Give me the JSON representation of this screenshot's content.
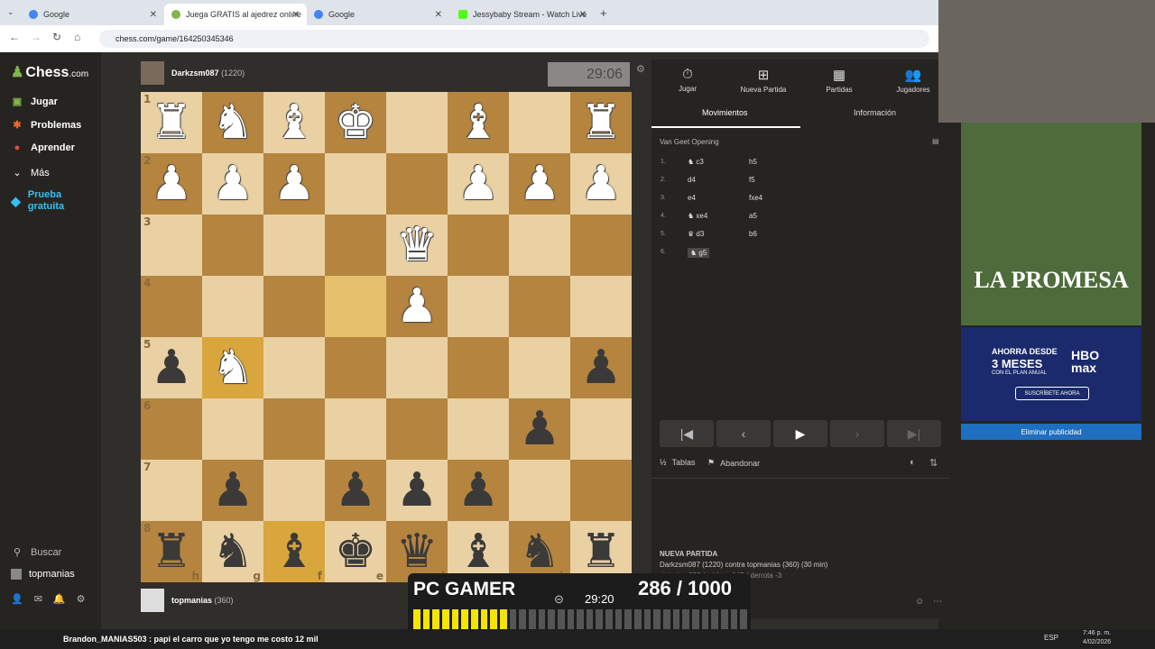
{
  "browser": {
    "tabs": [
      {
        "title": "Google",
        "favicon_color": "#4285f4",
        "active": false
      },
      {
        "title": "Juega GRATIS al ajedrez online",
        "favicon_color": "#81b64c",
        "active": true
      },
      {
        "title": "Google",
        "favicon_color": "#4285f4",
        "active": false
      },
      {
        "title": "Jessybaby Stream - Watch Live",
        "favicon_color": "#53fc18",
        "active": false
      }
    ],
    "url": "chess.com/game/164250345346"
  },
  "sidebar": {
    "logo": "Chess",
    "logo_suffix": ".com",
    "items": [
      {
        "label": "Jugar",
        "icon": "play-icon"
      },
      {
        "label": "Problemas",
        "icon": "puzzle-icon"
      },
      {
        "label": "Aprender",
        "icon": "learn-icon"
      },
      {
        "label": "Más",
        "icon": "chevron-down-icon"
      },
      {
        "label": "Prueba gratuita",
        "icon": "diamond-icon"
      }
    ],
    "search": "Buscar",
    "username": "topmanias"
  },
  "game": {
    "top_player": {
      "name": "Darkzsm087",
      "rating": "(1220)"
    },
    "top_clock": "29:06",
    "bottom_player": {
      "name": "topmanias",
      "rating": "(360)"
    },
    "board": [
      [
        "wR",
        "wN",
        "wB",
        "wK",
        "",
        "wB",
        "",
        "wR"
      ],
      [
        "wP",
        "wP",
        "wP",
        "",
        "",
        "wP",
        "wP",
        "wP"
      ],
      [
        "",
        "",
        "",
        "",
        "wQ",
        "",
        "",
        ""
      ],
      [
        "",
        "",
        "",
        "",
        "wP",
        "",
        "",
        ""
      ],
      [
        "bP",
        "wN",
        "",
        "",
        "",
        "",
        "",
        "bP"
      ],
      [
        "",
        "",
        "",
        "",
        "",
        "",
        "bP",
        ""
      ],
      [
        "",
        "bP",
        "",
        "bP",
        "bP",
        "bP",
        "",
        ""
      ],
      [
        "bR",
        "bN",
        "bB",
        "bK",
        "bQ",
        "bB",
        "bN",
        "bR"
      ]
    ],
    "ranks": [
      "1",
      "2",
      "3",
      "4",
      "5",
      "6",
      "7",
      "8"
    ],
    "files": [
      "h",
      "g",
      "f",
      "e",
      "d",
      "c",
      "b",
      "a"
    ]
  },
  "panel": {
    "top_tabs": [
      {
        "label": "Jugar",
        "icon": "clock-icon"
      },
      {
        "label": "Nueva Partida",
        "icon": "plus-icon"
      },
      {
        "label": "Partidas",
        "icon": "board-icon"
      },
      {
        "label": "Jugadores",
        "icon": "players-icon"
      }
    ],
    "sub_tabs": [
      "Movimientos",
      "Información"
    ],
    "opening": "Van Geet Opening",
    "moves": [
      {
        "n": "1.",
        "w": "♞ c3",
        "b": "h5"
      },
      {
        "n": "2.",
        "w": "d4",
        "b": "f5"
      },
      {
        "n": "3.",
        "w": "e4",
        "b": "fxe4"
      },
      {
        "n": "4.",
        "w": "♞ xe4",
        "b": "a5"
      },
      {
        "n": "5.",
        "w": "♛ d3",
        "b": "b6"
      },
      {
        "n": "6.",
        "w": "♞ g5",
        "b": ""
      }
    ],
    "draw": "Tablas",
    "resign": "Abandonar",
    "new_game_title": "NUEVA PARTIDA",
    "new_game_text": "Darkzsm087 (1220) contra topmanias (360) (30 min)",
    "record": "victoria +293 / tablas +145 / derrota -3"
  },
  "ads": {
    "ad1_title": "LA PROMESA",
    "ad2_line1": "AHORRA DESDE",
    "ad2_line2": "3 MESES",
    "ad2_line3": "CON EL PLAN ANUAL",
    "ad2_brand": "HBO max",
    "ad2_cta": "SUSCRÍBETE AHORA",
    "remove_ads": "Eliminar publicidad"
  },
  "overlay": {
    "title": "PC GAMER",
    "timer": "29:20",
    "counter": "286 / 1000",
    "progress": 0.286
  },
  "taskbar": {
    "chat": "Brandon_MANIAS503 : papi el carro que yo tengo me costo 12 mil",
    "lang": "ESP",
    "time": "7:46 p. m.",
    "date": "4/02/2026"
  }
}
